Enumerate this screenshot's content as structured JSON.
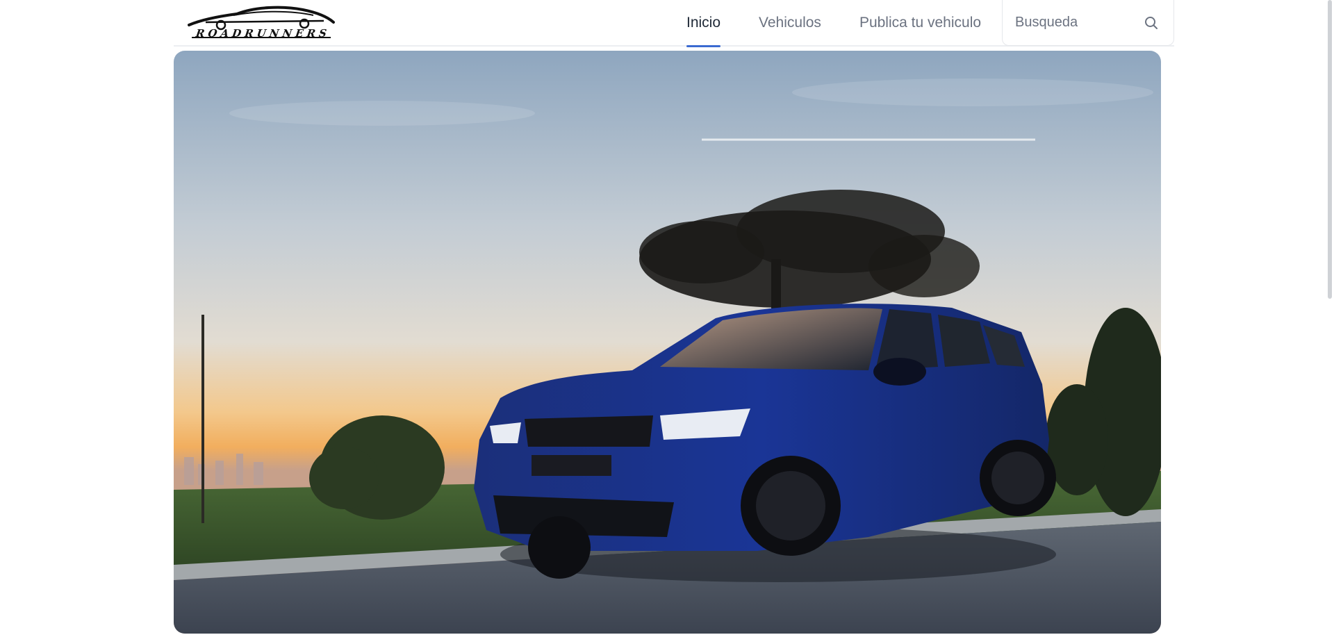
{
  "brand": {
    "logo_text": "ROADRUNNERS"
  },
  "nav": {
    "items": [
      {
        "label": "Inicio",
        "active": true
      },
      {
        "label": "Vehiculos",
        "active": false
      },
      {
        "label": "Publica tu vehiculo",
        "active": false
      }
    ]
  },
  "search": {
    "placeholder": "Busqueda",
    "value": "",
    "icon": "search-icon"
  },
  "hero": {
    "image": "blue-suv-at-sunset"
  },
  "colors": {
    "accent": "#3b6ad1",
    "nav_text": "#6b7280",
    "nav_text_active": "#1f2937"
  }
}
